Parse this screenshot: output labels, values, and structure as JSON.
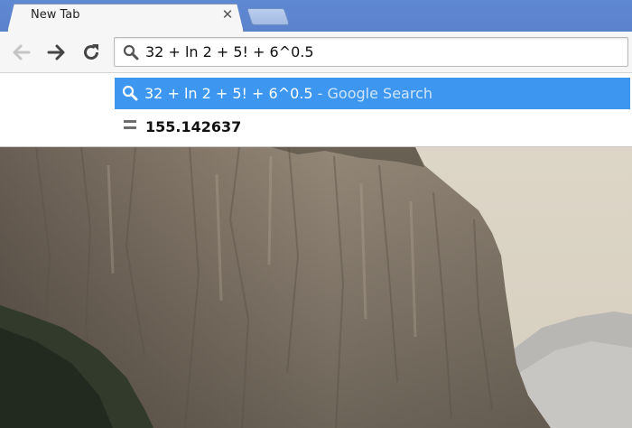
{
  "tab": {
    "title": "New Tab",
    "close_glyph": "✕"
  },
  "toolbar": {
    "back_icon": "back-arrow-icon",
    "forward_icon": "forward-arrow-icon",
    "reload_icon": "reload-icon"
  },
  "omnibox": {
    "value": "32 + ln 2 + 5! + 6^0.5",
    "icon": "search-icon"
  },
  "dropdown": {
    "suggestion": {
      "query": "32 + ln 2 + 5! + 6^0.5",
      "source": " - Google Search",
      "icon": "search-icon"
    },
    "calculator": {
      "icon": "equals-icon",
      "result": "155.142637"
    }
  },
  "colors": {
    "tabstrip": "#5f88d2",
    "selection": "#3d97f0",
    "toolbar": "#f6f6f6"
  },
  "background": {
    "description_icon": "landscape-wallpaper"
  }
}
